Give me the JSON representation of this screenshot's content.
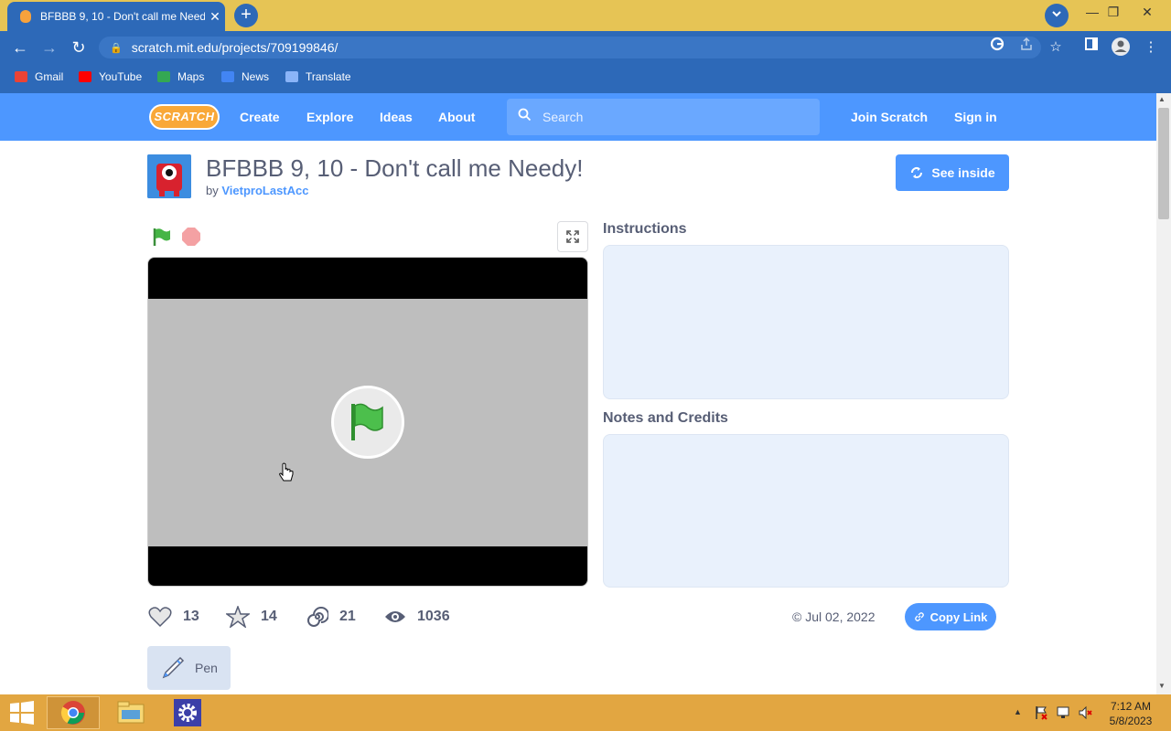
{
  "browser": {
    "tab_title": "BFBBB 9, 10 - Don't call me Needy!",
    "tab_title_display": "BFBBB 9, 10 - Don't call me Need",
    "close_glyph": "✕",
    "new_tab_glyph": "+",
    "url": "scratch.mit.edu/projects/709199846/",
    "bookmarks": [
      {
        "label": "Gmail",
        "color": "#ea4335"
      },
      {
        "label": "YouTube",
        "color": "#ff0000"
      },
      {
        "label": "Maps",
        "color": "#34a853"
      },
      {
        "label": "News",
        "color": "#4285f4"
      },
      {
        "label": "Translate",
        "color": "#4285f4"
      }
    ]
  },
  "scratch_nav": {
    "logo": "SCRATCH",
    "links": [
      "Create",
      "Explore",
      "Ideas",
      "About"
    ],
    "search_placeholder": "Search",
    "join": "Join Scratch",
    "sign_in": "Sign in"
  },
  "project": {
    "title": "BFBBB 9, 10 - Don't call me Needy!",
    "by": "by",
    "author": "VietproLastAcc",
    "see_inside": "See inside",
    "instructions_label": "Instructions",
    "notes_label": "Notes and Credits",
    "stats": {
      "loves": "13",
      "favorites": "14",
      "remixes": "21",
      "views": "1036"
    },
    "shared_date": "Jul 02, 2022",
    "copy_link": "Copy Link",
    "tag": "Pen"
  },
  "taskbar": {
    "time": "7:12 AM",
    "date": "5/8/2023"
  },
  "colors": {
    "scratch_blue": "#4d97ff",
    "chrome_frame": "#2d69b8",
    "tab_strip": "#e6c455",
    "taskbar": "#e2a641"
  }
}
